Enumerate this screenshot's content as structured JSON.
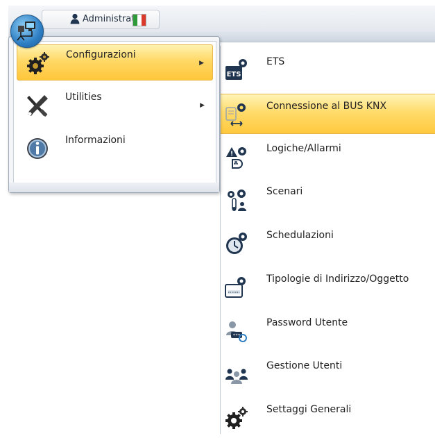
{
  "header": {
    "user_name": "Administrator",
    "flag_colors": [
      "#2e9a3a",
      "#ffffff",
      "#d93a2b"
    ]
  },
  "main_menu": {
    "items": [
      {
        "label": "Configurazioni",
        "icon": "gears-icon",
        "selected": true,
        "has_submenu": true
      },
      {
        "label": "Utilities",
        "icon": "tools-icon",
        "selected": false,
        "has_submenu": true
      },
      {
        "label": "Informazioni",
        "icon": "info-icon",
        "selected": false,
        "has_submenu": false
      }
    ]
  },
  "sub_menu": {
    "items": [
      {
        "label": "ETS",
        "icon": "ets-icon"
      },
      {
        "label": "Connessione al BUS KNX",
        "icon": "bus-connection-icon",
        "selected": true
      },
      {
        "label": "Logiche/Allarmi",
        "icon": "logic-alarm-icon"
      },
      {
        "label": "Scenari",
        "icon": "scenario-icon"
      },
      {
        "label": "Schedulazioni",
        "icon": "schedule-clock-icon"
      },
      {
        "label": "Tipologie di Indirizzo/Oggetto",
        "icon": "address-type-icon"
      },
      {
        "label": "Password Utente",
        "icon": "user-password-icon"
      },
      {
        "label": "Gestione Utenti",
        "icon": "user-management-icon"
      },
      {
        "label": "Settaggi Generali",
        "icon": "general-settings-icon"
      }
    ]
  },
  "colors": {
    "highlight": "#ffd866",
    "icon_dark": "#1f3550",
    "accent_blue": "#2f7fc4"
  }
}
